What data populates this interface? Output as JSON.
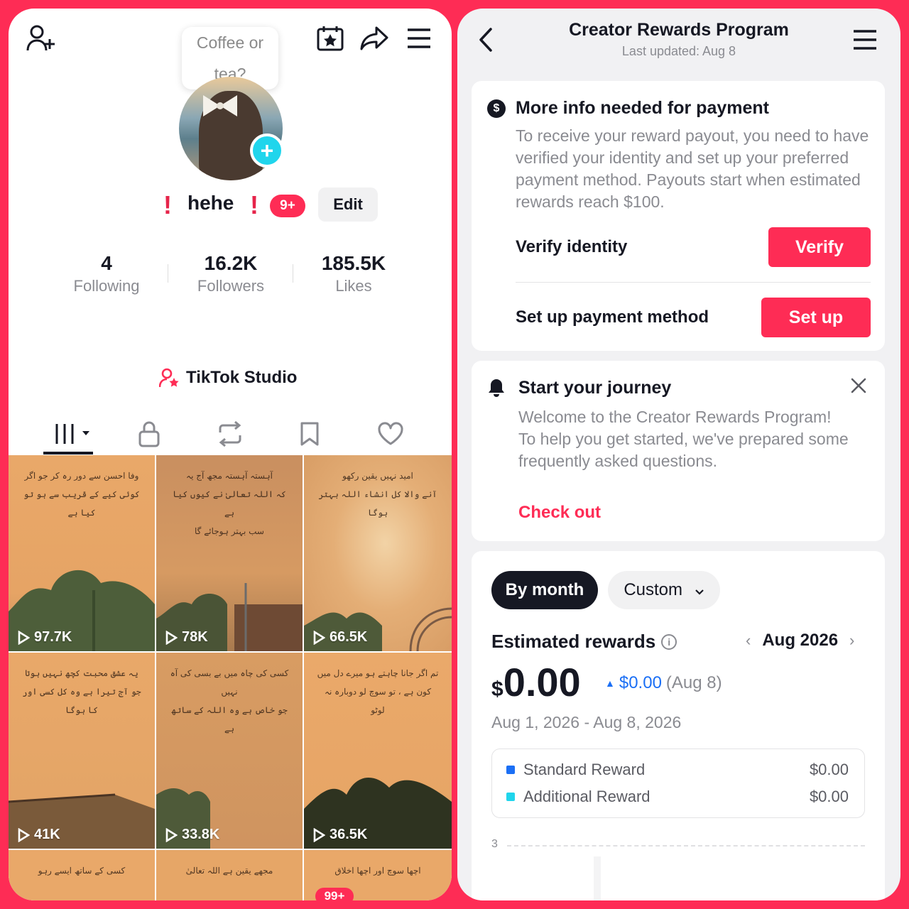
{
  "profile": {
    "bubble_text": "Coffee or tea?",
    "username": "hehe",
    "excl_mark": "!",
    "notif_badge": "9+",
    "edit_label": "Edit",
    "stats": [
      {
        "num": "4",
        "label": "Following"
      },
      {
        "num": "16.2K",
        "label": "Followers"
      },
      {
        "num": "185.5K",
        "label": "Likes"
      }
    ],
    "studio_label": "TikTok Studio",
    "videos": [
      {
        "views": "97.7K"
      },
      {
        "views": "78K"
      },
      {
        "views": "66.5K"
      },
      {
        "views": "41K"
      },
      {
        "views": "33.8K"
      },
      {
        "views": "36.5K"
      }
    ],
    "bottom_badge": "99+",
    "colors": {
      "accent": "#fe2c55",
      "plus": "#20d5ec",
      "tile": "#e9a869"
    }
  },
  "rewards": {
    "title": "Creator Rewards Program",
    "subtitle": "Last updated: Aug 8",
    "payment_card": {
      "icon": "$",
      "title": "More info needed for payment",
      "body": "To receive your reward payout, you need to have verified your identity and set up your preferred payment method. Payouts start when estimated rewards reach $100.",
      "verify_label": "Verify identity",
      "verify_btn": "Verify",
      "setup_label": "Set up payment method",
      "setup_btn": "Set up"
    },
    "journey_card": {
      "title": "Start your journey",
      "body": "Welcome to the Creator Rewards Program! To help you get started, we've prepared some frequently asked questions.",
      "link": "Check out"
    },
    "estimate": {
      "by_month": "By month",
      "custom": "Custom",
      "title": "Estimated rewards",
      "month": "Aug 2026",
      "currency": "$",
      "amount": "0.00",
      "delta_value": "$0.00",
      "delta_date": "(Aug 8)",
      "range": "Aug 1, 2026 - Aug 8, 2026",
      "legend": [
        {
          "name": "Standard Reward",
          "value": "$0.00",
          "color": "#1b6ff5"
        },
        {
          "name": "Additional Reward",
          "value": "$0.00",
          "color": "#20d5ec"
        }
      ],
      "axis_tick": "3"
    }
  }
}
